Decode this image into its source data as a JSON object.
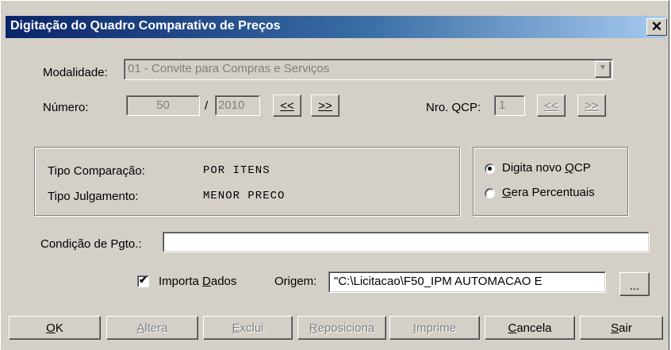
{
  "window": {
    "title": "Digitação do Quadro Comparativo de Preços",
    "close_glyph": "✕"
  },
  "modalidade": {
    "label": "Modalidade:",
    "value": "01 - Convite para Compras e Serviços",
    "dropdown_glyph": "▼"
  },
  "numero": {
    "label": "Número:",
    "value": "50",
    "separator": "/",
    "year": "2010",
    "prev_label": "<<",
    "next_label": ">>"
  },
  "qcp": {
    "label": "Nro. QCP:",
    "value": "1",
    "prev_label": "<<",
    "next_label": ">>"
  },
  "info": {
    "tipo_comparacao_label": "Tipo Comparação:",
    "tipo_comparacao_value": "POR ITENS",
    "tipo_julgamento_label": "Tipo Julgamento:",
    "tipo_julgamento_value": "MENOR PRECO"
  },
  "options": {
    "digita_pre": "Digita novo ",
    "digita_key": "Q",
    "digita_post": "CP",
    "digita_selected": true,
    "gera_key": "G",
    "gera_post": "era Percentuais",
    "gera_selected": false
  },
  "condicao": {
    "label": "Condição de Pgto.:",
    "value": ""
  },
  "importa": {
    "checked": true,
    "check_glyph": "✔",
    "pre": "Importa ",
    "key": "D",
    "post": "ados",
    "origem_label": "Origem:",
    "origem_value": "\"C:\\Licitacao\\F50_IPM AUTOMACAO E",
    "browse_label": "..."
  },
  "buttons": [
    {
      "key": "O",
      "rest": "K",
      "enabled": true
    },
    {
      "key": "A",
      "rest": "ltera",
      "enabled": false
    },
    {
      "key": "E",
      "rest": "xclui",
      "enabled": false
    },
    {
      "key": "R",
      "rest": "eposiciona",
      "enabled": false
    },
    {
      "key": "I",
      "rest": "mprime",
      "enabled": false
    },
    {
      "key": "C",
      "rest": "ancela",
      "enabled": true
    },
    {
      "key": "S",
      "rest": "air",
      "enabled": true
    }
  ]
}
